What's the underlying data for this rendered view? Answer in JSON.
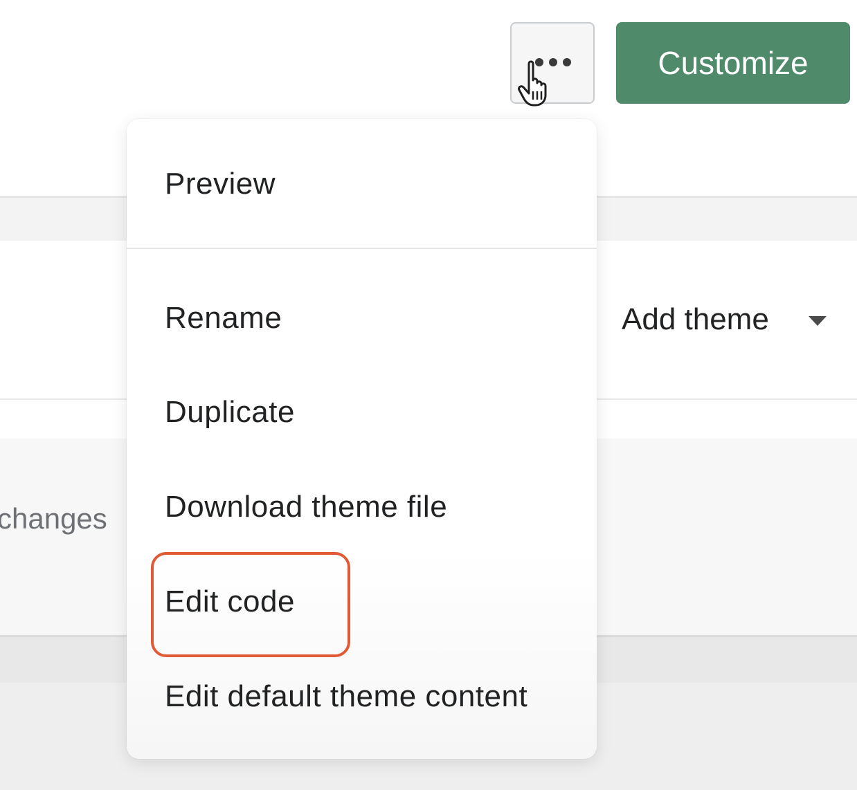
{
  "header": {
    "more_actions_icon": "ellipsis-icon",
    "customize_label": "Customize",
    "colors": {
      "customize_bg": "#4f8a6b",
      "highlight": "#e05a36"
    }
  },
  "toolbar": {
    "add_theme_label": "Add theme",
    "add_theme_icon": "caret-down-icon"
  },
  "content": {
    "changes_text": "changes"
  },
  "menu": {
    "items": [
      {
        "label": "Preview"
      },
      {
        "label": "Rename"
      },
      {
        "label": "Duplicate"
      },
      {
        "label": "Download theme file"
      },
      {
        "label": "Edit code",
        "highlighted": true
      },
      {
        "label": "Edit default theme content"
      }
    ]
  },
  "cursor": {
    "icon": "hand-pointer-icon"
  }
}
